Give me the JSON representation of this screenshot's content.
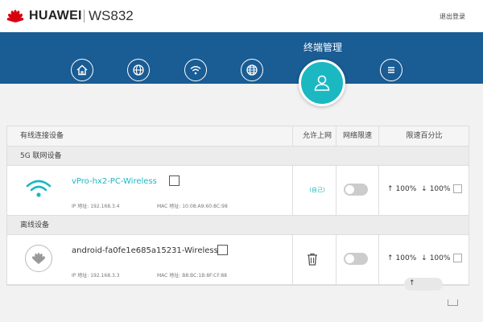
{
  "header": {
    "brand": "HUAWEI",
    "model": "WS832",
    "logout": "退出登录"
  },
  "nav": {
    "items": [
      {
        "icon": "home-icon"
      },
      {
        "icon": "globe-icon"
      },
      {
        "icon": "wifi-icon"
      },
      {
        "icon": "globe-settings-icon"
      },
      {
        "icon": "user-icon",
        "label": "终端管理",
        "active": true
      },
      {
        "icon": "menu-icon"
      }
    ],
    "active_label": "终端管理"
  },
  "table": {
    "columns": [
      "有线连接设备",
      "允许上网",
      "网络限速",
      "限速百分比"
    ],
    "sections": [
      {
        "title": "5G 联网设备",
        "devices": [
          {
            "name": "vPro-hx2-PC-Wireless",
            "ip": "IP 地址: 192.168.3.4",
            "mac": "MAC 地址: 10:08:A9:60:8C:98",
            "allowed": "(自己)",
            "up": "100%",
            "down": "100%"
          }
        ]
      },
      {
        "title": "离线设备",
        "devices": [
          {
            "name": "android-fa0fe1e685a15231-Wireless",
            "ip": "IP 地址: 192.168.3.3",
            "mac": "MAC 地址: B8:BC:1B:8F:CF:88",
            "up": "100%",
            "down": "100%"
          }
        ]
      }
    ]
  },
  "colors": {
    "band": "#1a5c94",
    "accent": "#1bb8c2"
  }
}
